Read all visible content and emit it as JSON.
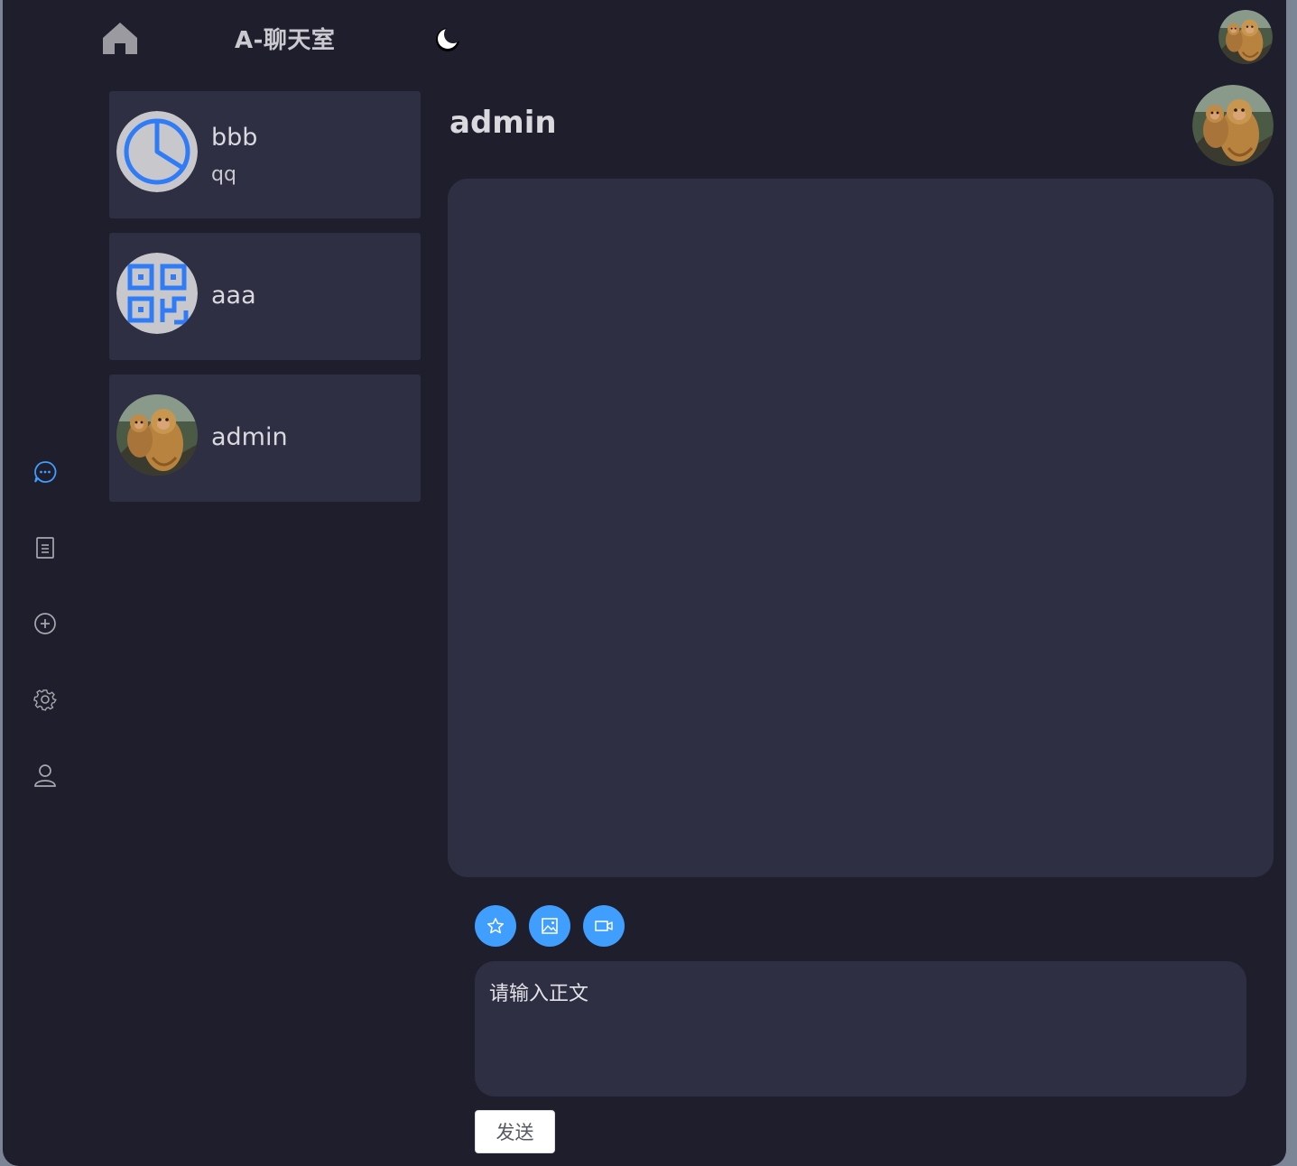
{
  "app": {
    "title": "A-聊天室"
  },
  "topbar": {
    "home_icon": "home-icon",
    "theme_icon": "moon-icon",
    "user_avatar": "monkey-photo-avatar"
  },
  "sidenav": {
    "items": [
      {
        "icon": "chat-bubble-icon",
        "active": true
      },
      {
        "icon": "document-icon",
        "active": false
      },
      {
        "icon": "add-circle-icon",
        "active": false
      },
      {
        "icon": "gear-icon",
        "active": false
      },
      {
        "icon": "user-icon",
        "active": false
      }
    ]
  },
  "contacts": [
    {
      "name": "bbb",
      "last_message": "qq",
      "avatar_icon": "pie-chart-icon"
    },
    {
      "name": "aaa",
      "last_message": "",
      "avatar_icon": "qr-code-icon"
    },
    {
      "name": "admin",
      "last_message": "",
      "avatar_icon": "monkey-photo-avatar"
    }
  ],
  "chat": {
    "title": "admin"
  },
  "toolbar": {
    "buttons": [
      "star-icon",
      "image-icon",
      "video-camera-icon"
    ]
  },
  "composer": {
    "placeholder": "请输入正文",
    "send_label": "发送"
  },
  "colors": {
    "accent": "#409eff",
    "background": "#1f1e2c",
    "panel": "#2e2f42",
    "text": "#d9d9de"
  }
}
